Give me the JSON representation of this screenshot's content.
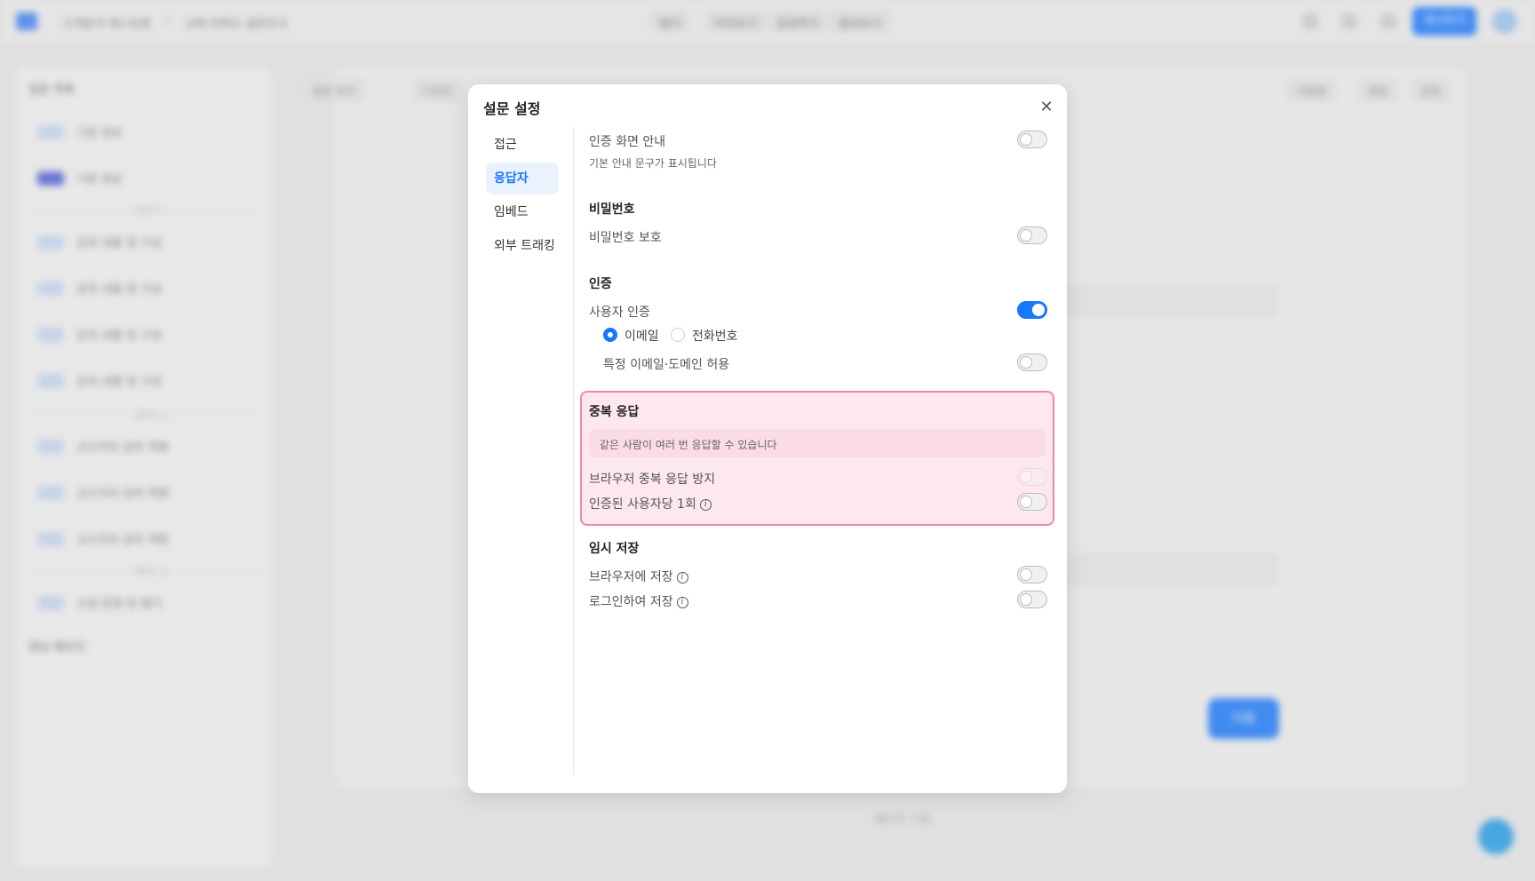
{
  "background": {
    "breadcrumb": [
      "고객분석 레스토랑",
      "교육 만족도 설문조사"
    ],
    "nav_tabs": [
      "빌더",
      "미리보기",
      "공유하기",
      "결과보기"
    ],
    "publish_label": "게시하기",
    "sidebar_title": "질문 목록",
    "sidebar_footer": "엔딩 페이지",
    "sidebar_items": [
      "기본 정보",
      "기본 정보",
      "강의 내용 및 구성",
      "강의 내용 및 구성",
      "강의 내용 및 구성",
      "강의 내용 및 구성",
      "교수자의 강의 역량",
      "교수자의 강의 역량",
      "교수자의 강의 역량",
      "수업 운영 및 평가"
    ],
    "separators": [
      "페이지 1",
      "페이지 2",
      "페이지 3"
    ],
    "tools": [
      "질문 추가",
      "디자인"
    ],
    "right_tools": [
      "저장됨",
      "편집",
      "공유"
    ],
    "next_label": "다음",
    "bottom_label": "페이지 구분"
  },
  "modal": {
    "title": "설문 설정",
    "close_icon": "close-icon",
    "nav": [
      "접근",
      "응답자",
      "임베드",
      "외부 트래킹"
    ],
    "active_nav": 1,
    "auth_screen": {
      "label": "인증 화면 안내",
      "desc": "기본 안내 문구가 표시됩니다",
      "on": false
    },
    "password": {
      "title": "비밀번호",
      "label": "비밀번호 보호",
      "on": false
    },
    "auth": {
      "title": "인증",
      "user_auth_label": "사용자 인증",
      "user_auth_on": true,
      "options": [
        "이메일",
        "전화번호"
      ],
      "selected": 0,
      "domain_label": "특정 이메일·도메인 허용",
      "domain_on": false
    },
    "duplicate": {
      "title": "중복 응답",
      "notice": "같은 사람이 여러 번 응답할 수 있습니다",
      "browser_label": "브라우저 중복 응답 방지",
      "browser_on": false,
      "per_user_label": "인증된 사용자당 1회",
      "per_user_on": false,
      "highlight_color": "#ef86b0"
    },
    "temp_save": {
      "title": "임시 저장",
      "browser_label": "브라우저에 저장",
      "browser_on": false,
      "login_label": "로그인하여 저장",
      "login_on": false
    },
    "accent_color": "#1677ff"
  }
}
